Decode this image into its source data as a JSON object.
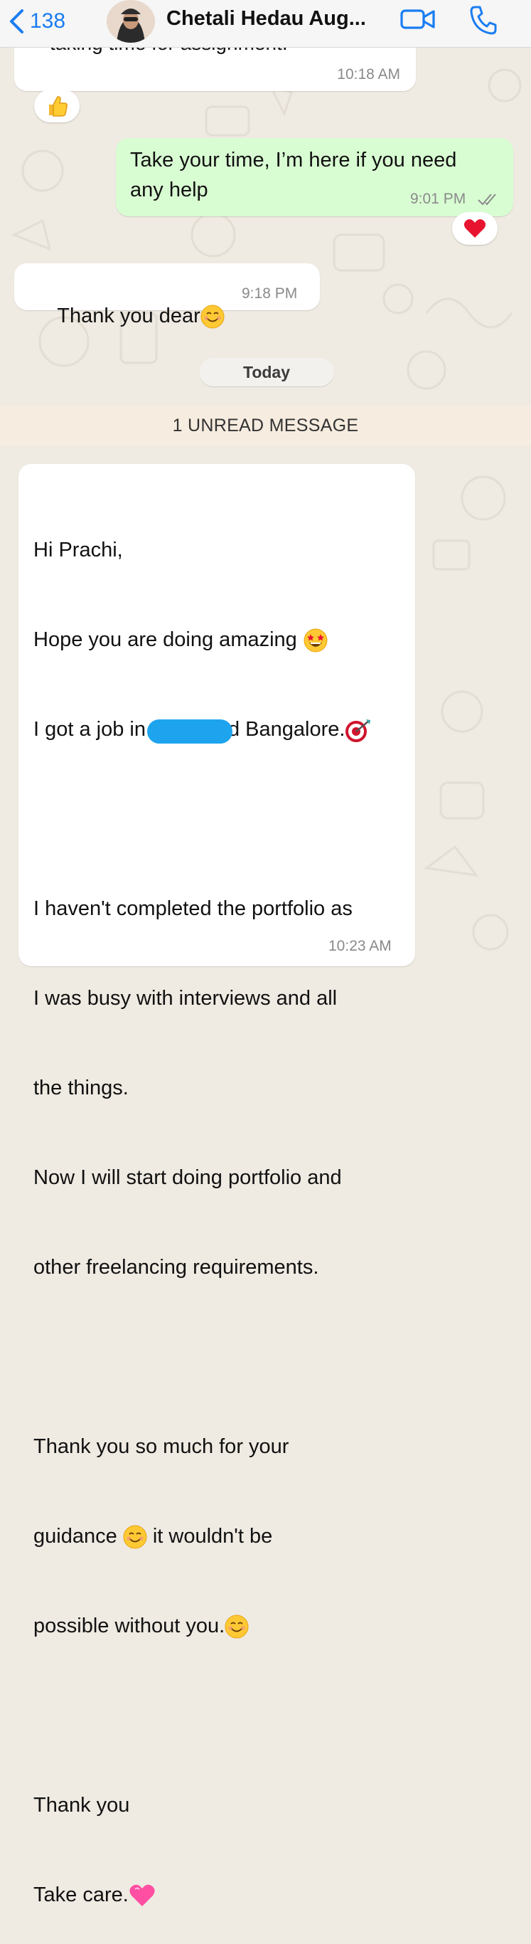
{
  "header": {
    "back_count": "138",
    "contact_name": "Chetali Hedau Aug..."
  },
  "icons": {
    "back": "chevron-left-icon",
    "video": "video-camera-icon",
    "call": "phone-icon",
    "read_receipt": "double-check-icon"
  },
  "colors": {
    "accent": "#1a7df1",
    "outgoing_bubble": "#d9fdd3",
    "incoming_bubble": "#ffffff",
    "chat_background": "#efeae2",
    "unread_bar": "#f6ecdf"
  },
  "messages": [
    {
      "direction": "incoming",
      "text": "taking time for assignment.",
      "time": "10:18 AM",
      "reaction": "thumbs-up"
    },
    {
      "direction": "outgoing",
      "lines": [
        "Take your time, I’m here if you need",
        "any help"
      ],
      "time": "9:01 PM",
      "status": "read",
      "reaction": "red-heart"
    },
    {
      "direction": "incoming",
      "text": "Thank you dear",
      "time": "9:18 PM"
    }
  ],
  "date_separator": "Today",
  "unread_banner": "1 UNREAD MESSAGE",
  "long_message": {
    "time": "10:23 AM",
    "line1": "Hi Prachi,",
    "line2": "Hope you are doing amazing",
    "line3_before": "I got a job in",
    "line3_after": "d Bangalore.",
    "para2": [
      "I haven't completed the portfolio as",
      "I was busy with interviews and all",
      "the things.",
      "Now I will start doing portfolio and",
      "other freelancing requirements."
    ],
    "para3_line1": "Thank you so much for your",
    "para3_line2_a": "guidance",
    "para3_line2_b": "it wouldn't be",
    "para3_line3": "possible without you.",
    "para4_line1": "Thank you",
    "para4_line2": "Take care."
  }
}
